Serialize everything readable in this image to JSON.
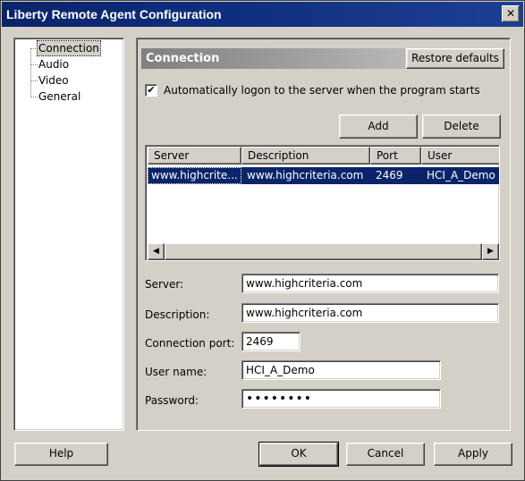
{
  "window": {
    "title": "Liberty Remote Agent Configuration",
    "close_glyph": "✕"
  },
  "tree": {
    "items": [
      {
        "label": "Connection",
        "selected": true
      },
      {
        "label": "Audio"
      },
      {
        "label": "Video"
      },
      {
        "label": "General"
      }
    ]
  },
  "panel": {
    "title": "Connection",
    "restore_defaults": "Restore defaults",
    "auto_logon": {
      "label": "Automatically logon to the server when the program starts",
      "checked": true,
      "glyph": "✔"
    },
    "add": "Add",
    "delete": "Delete",
    "list": {
      "columns": [
        "Server",
        "Description",
        "Port",
        "User"
      ],
      "rows": [
        {
          "server": "www.highcrite...",
          "description": "www.highcriteria.com",
          "port": "2469",
          "user": "HCI_A_Demo",
          "selected": true
        }
      ],
      "scroll_left": "◀",
      "scroll_right": "▶"
    },
    "fields": {
      "server": {
        "label": "Server:",
        "value": "www.highcriteria.com"
      },
      "description": {
        "label": "Description:",
        "value": "www.highcriteria.com"
      },
      "port": {
        "label": "Connection port:",
        "value": "2469"
      },
      "username": {
        "label": "User name:",
        "value": "HCI_A_Demo"
      },
      "password": {
        "label": "Password:",
        "value": "••••••••"
      }
    }
  },
  "footer": {
    "help": "Help",
    "ok": "OK",
    "cancel": "Cancel",
    "apply": "Apply"
  },
  "colors": {
    "title_bar": "#0a246a",
    "selection": "#0a246a",
    "face": "#d4d0c8"
  }
}
